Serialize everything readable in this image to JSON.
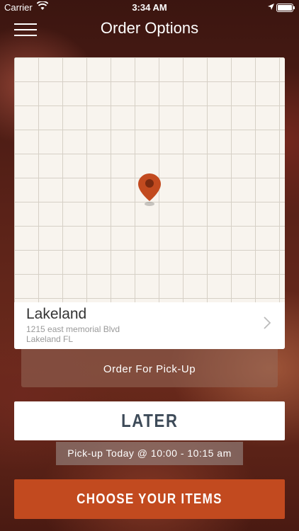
{
  "status_bar": {
    "carrier": "Carrier",
    "time": "3:34 AM"
  },
  "nav": {
    "title": "Order Options",
    "menu_icon": "hamburger-menu-icon"
  },
  "map": {
    "pin_icon": "map-pin-icon",
    "pin_color": "#c24a1f"
  },
  "location": {
    "name": "Lakeland",
    "address_line1": "1215 east memorial Blvd",
    "address_line2": "Lakeland  FL",
    "chevron_icon": "chevron-right-icon"
  },
  "order_type": {
    "label": "Order For Pick-Up"
  },
  "timing": {
    "later_label": "LATER",
    "pickup_info": "Pick-up Today @ 10:00 - 10:15 am"
  },
  "actions": {
    "choose_items_label": "CHOOSE YOUR ITEMS",
    "accent_color": "#c24a1f"
  }
}
